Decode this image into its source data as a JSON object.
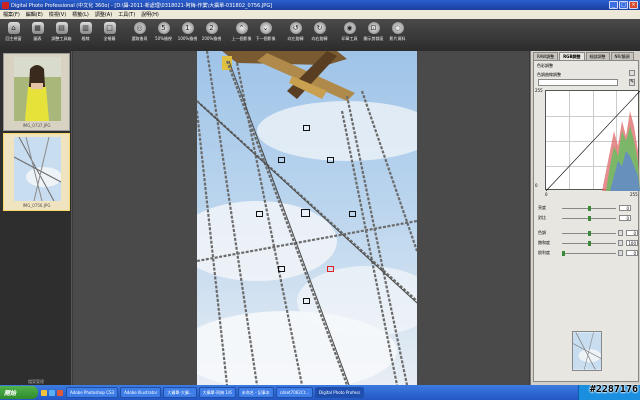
{
  "window": {
    "title": "Digital Photo Professional (中文化 360o) - [D:\\攝-2011-新處理\\0318021-阿梅-作業\\大攝單-031802_0756.JPG]",
    "controls": [
      "_",
      "□",
      "×"
    ]
  },
  "menu": [
    "檔案(F)",
    "編輯(E)",
    "檢視(V)",
    "標籤(L)",
    "調整(A)",
    "工具(T)",
    "說明(H)"
  ],
  "toolbar": [
    {
      "label": "回主視窗",
      "icon": "home-icon"
    },
    {
      "label": "圖表",
      "icon": "grid-icon"
    },
    {
      "label": "調整工具箱",
      "icon": "toolbox-icon"
    },
    {
      "label": "格線",
      "icon": "gridline-icon"
    },
    {
      "label": "全螢幕",
      "icon": "fullscreen-icon"
    },
    {
      "label": "選取後再",
      "icon": "select-icon"
    },
    {
      "label": "50%檢視",
      "icon": "zoom-50-icon"
    },
    {
      "label": "100%檢視",
      "icon": "zoom-100-icon"
    },
    {
      "label": "200%檢視",
      "icon": "zoom-200-icon"
    },
    {
      "label": "上一個影像",
      "icon": "prev-icon"
    },
    {
      "label": "下一個影像",
      "icon": "next-icon"
    },
    {
      "label": "向左旋轉",
      "icon": "rotate-left-icon"
    },
    {
      "label": "向右旋轉",
      "icon": "rotate-right-icon"
    },
    {
      "label": "印章工具",
      "icon": "stamp-icon"
    },
    {
      "label": "顯示剪裁區",
      "icon": "crop-icon"
    },
    {
      "label": "影片資料",
      "icon": "info-icon"
    }
  ],
  "thumbnails": [
    {
      "caption": "IMG_0737.JPG",
      "selected": false
    },
    {
      "caption": "IMG_0756.JPG",
      "selected": true
    }
  ],
  "left_panel_label": "檔案管理",
  "palette": {
    "tabs": [
      "RAW調整",
      "RGB調整",
      "細部調整",
      "NR/鏡頭"
    ],
    "section": "色彩調整",
    "curve_label": "色調曲線調整",
    "curve_min": "0",
    "curve_max": "255",
    "curve_top_left": "255",
    "curve_bottom_left": "0",
    "sliders": [
      {
        "label": "亮度",
        "value": "0"
      },
      {
        "label": "對比",
        "value": "0"
      },
      {
        "label": "色調",
        "value": "0"
      },
      {
        "label": "飽和度",
        "value": "100"
      },
      {
        "label": "銳利度",
        "value": "0"
      }
    ]
  },
  "taskbar": {
    "start": "開始",
    "items": [
      {
        "label": "Adobe Photoshop CS3",
        "active": false
      },
      {
        "label": "Adobe Illustrator",
        "active": false
      },
      {
        "label": "大攝單-大攝...",
        "active": false
      },
      {
        "label": "大攝單-阿梅 1/6",
        "active": false
      },
      {
        "label": "未命名 - 記事本",
        "active": false
      },
      {
        "label": "cdset7062Ct...",
        "active": false
      },
      {
        "label": "Digital Photo Profess",
        "active": true
      }
    ]
  },
  "watermark": "#2287176"
}
